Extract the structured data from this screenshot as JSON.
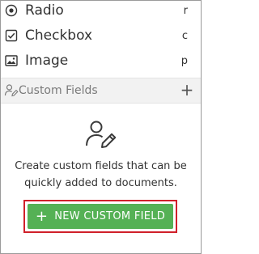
{
  "field_types": [
    {
      "label": "Radio",
      "shortcut": "r",
      "icon": "radio-icon"
    },
    {
      "label": "Checkbox",
      "shortcut": "c",
      "icon": "checkbox-icon"
    },
    {
      "label": "Image",
      "shortcut": "p",
      "icon": "image-icon"
    }
  ],
  "custom_fields": {
    "title": "Custom Fields",
    "icon": "user-edit-icon",
    "add_icon": "plus-icon",
    "add_label": "+",
    "empty_icon": "user-edit-icon",
    "empty_text": "Create custom fields that can be quickly added to documents.",
    "new_button": {
      "plus": "+",
      "label": "NEW CUSTOM FIELD"
    }
  },
  "colors": {
    "button_bg": "#55b155",
    "highlight_border": "#d0202a",
    "section_bg": "#f2f2f2"
  }
}
